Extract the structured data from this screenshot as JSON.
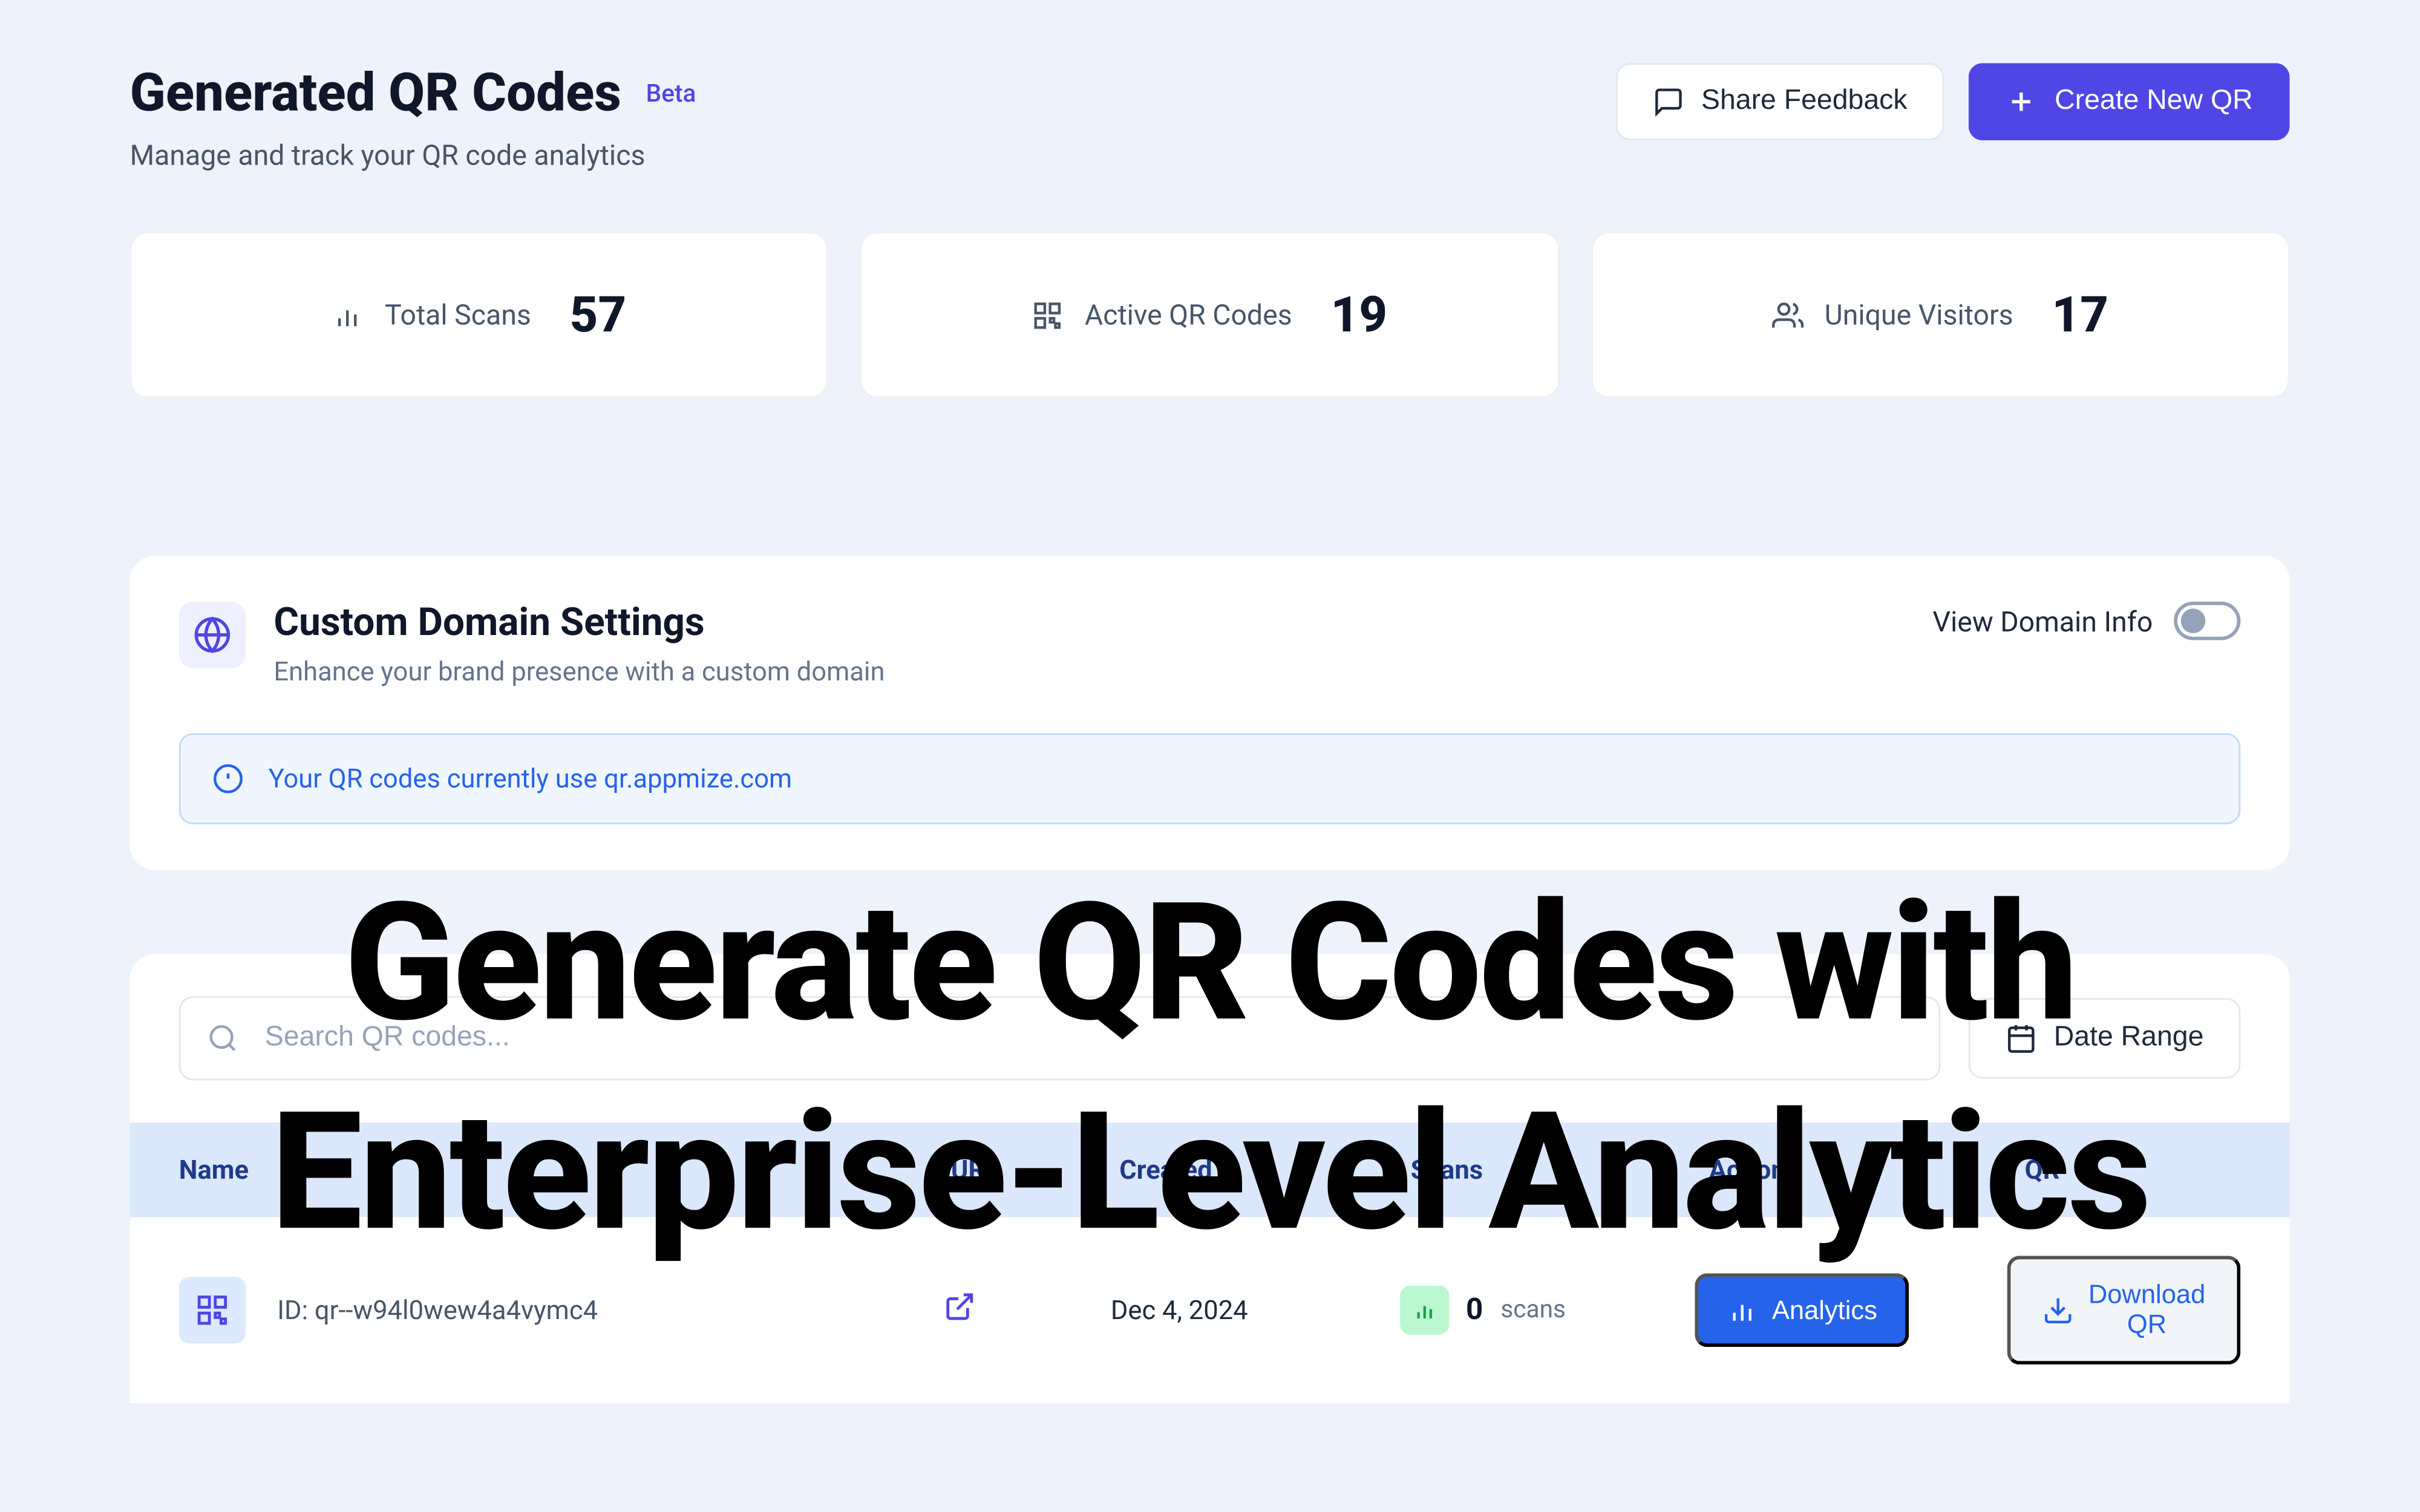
{
  "header": {
    "title": "Generated QR Codes",
    "badge": "Beta",
    "subtitle": "Manage and track your QR code analytics",
    "share_label": "Share Feedback",
    "create_label": "Create New QR"
  },
  "stats": {
    "total_scans_label": "Total Scans",
    "total_scans_value": "57",
    "active_label": "Active QR Codes",
    "active_value": "19",
    "visitors_label": "Unique Visitors",
    "visitors_value": "17"
  },
  "domain_panel": {
    "title": "Custom Domain Settings",
    "subtitle": "Enhance your brand presence with a custom domain",
    "toggle_label": "View Domain Info",
    "info_text": "Your QR codes currently use qr.appmize.com"
  },
  "search": {
    "placeholder": "Search QR codes...",
    "date_range_label": "Date Range"
  },
  "table": {
    "columns": {
      "name": "Name",
      "url": "URL",
      "created": "Created",
      "scans": "Scans",
      "actions": "Actions",
      "qr": "QR"
    },
    "row": {
      "id_label": "ID: qr--w94l0wew4a4vymc4",
      "created": "Dec 4, 2024",
      "scans_value": "0",
      "scans_unit": "scans",
      "analytics_label": "Analytics",
      "download_label": "Download QR"
    }
  },
  "hero": {
    "line1": "Generate QR Codes with",
    "line2": "Enterprise-Level Analytics"
  }
}
